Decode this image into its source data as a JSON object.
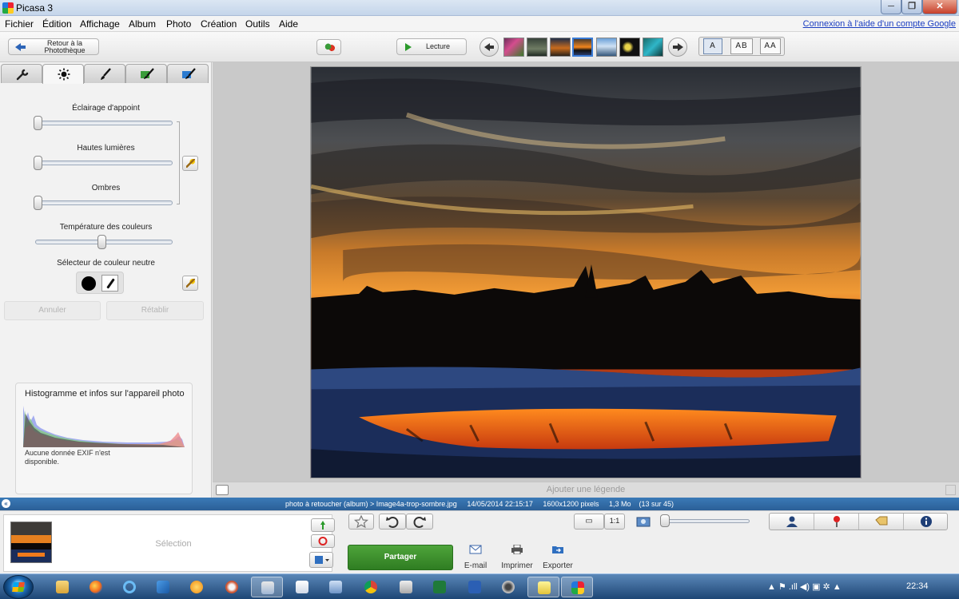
{
  "window": {
    "title": "Picasa 3",
    "controls": {
      "minimize": "─",
      "maximize": "❐",
      "close": "✕"
    }
  },
  "menu": {
    "items": [
      "Fichier",
      "Édition",
      "Affichage",
      "Album",
      "Photo",
      "Création",
      "Outils",
      "Aide"
    ],
    "help_link": "Connexion à l'aide d'un compte Google"
  },
  "toolbar": {
    "back_label": "Retour à la Photothèque",
    "play_label": "Lecture",
    "thumbnail_count": 7,
    "selected_thumbnail": 4,
    "caption_modes": [
      "A",
      "AB",
      "AA"
    ]
  },
  "left_panel": {
    "tabs": [
      {
        "name": "wrench-icon"
      },
      {
        "name": "sun-icon"
      },
      {
        "name": "brush-icon"
      },
      {
        "name": "effects-brush-icon"
      },
      {
        "name": "effects-brush-2-icon"
      }
    ],
    "active_tab": 1,
    "sliders": [
      {
        "label": "Éclairage d'appoint",
        "value": 0.0
      },
      {
        "label": "Hautes lumières",
        "value": 0.0
      },
      {
        "label": "Ombres",
        "value": 0.0
      },
      {
        "label": "Température des couleurs",
        "value": 0.5
      }
    ],
    "neutral_picker_label": "Sélecteur de couleur neutre",
    "undo_label": "Annuler",
    "redo_label": "Rétablir",
    "histogram_title": "Histogramme et infos sur l'appareil photo",
    "exif_note": "Aucune donnée EXIF n'est disponible."
  },
  "main": {
    "caption_placeholder": "Ajouter une légende"
  },
  "status": {
    "path": "photo à retoucher (album) > Image4a-trop-sombre.jpg",
    "datetime": "14/05/2014 22:15:17",
    "dimensions": "1600x1200 pixels",
    "size": "1,3 Mo",
    "position": "(13 sur 45)",
    "collapse_glyph": "«"
  },
  "tray": {
    "selection_label": "Sélection",
    "share_label": "Partager",
    "actions": [
      {
        "label": "E-mail",
        "icon": "email-icon"
      },
      {
        "label": "Imprimer",
        "icon": "printer-icon"
      },
      {
        "label": "Exporter",
        "icon": "export-icon"
      }
    ],
    "zoom_level": 0.0,
    "zoom_buttons": [
      "▭",
      "1:1"
    ],
    "right_tabs": [
      "people-icon",
      "map-pin-icon",
      "tag-icon",
      "info-icon"
    ]
  },
  "taskbar": {
    "clock": "22:34",
    "tray_glyphs": "▲  ⚑  .ıll  ◀)  ▣  ✲  ▲"
  }
}
